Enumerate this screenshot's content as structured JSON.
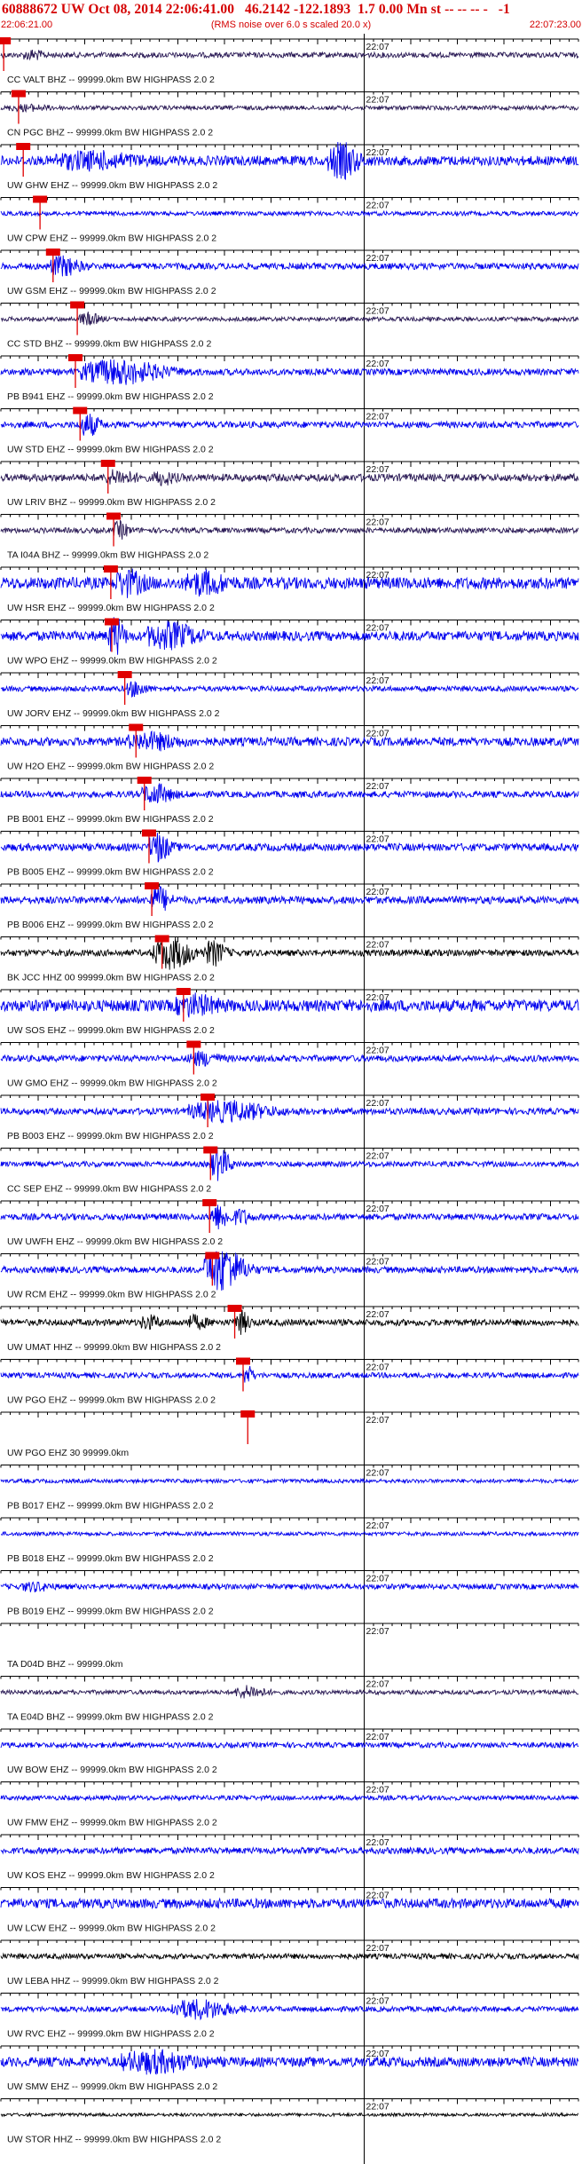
{
  "header": {
    "title": "60888672 UW Oct 08, 2014 22:06:41.00   46.2142 -122.1893  1.7 0.00 Mn st -- -- -- -   -1",
    "start_time": "22:06:21.00",
    "note": "(RMS noise over 6.0 s scaled 20.0 x)",
    "end_time": "22:07:23.00"
  },
  "colors": {
    "header_text": "#d40000",
    "trace_blue": "#0000ee",
    "trace_dark": "#2a1a55",
    "trace_black": "#000000",
    "pick_red": "#e00000",
    "axis": "#000000"
  },
  "chart_data": {
    "type": "line",
    "title": "60888672 UW Oct 08, 2014 22:06:41.00   46.2142 -122.1893  1.7 0.00 Mn st -- -- -- -   -1",
    "xlabel": "",
    "ylabel": "",
    "x_range": [
      "22:06:21.00",
      "22:07:23.00"
    ],
    "minute_tick_label": "22:07",
    "grid": true,
    "series": [
      {
        "name": "CC VALT BHZ -- 99999.0km BW  HIGHPASS  2.0  2",
        "color": "dark",
        "amp": 0.25,
        "pick": 0.3,
        "bursts": [
          {
            "at": 3,
            "w": 2,
            "a": 0.35
          }
        ]
      },
      {
        "name": "CN PGC BHZ -- 99999.0km BW  HIGHPASS  2.0  2",
        "color": "dark",
        "amp": 0.2,
        "pick": 1.9,
        "bursts": [
          {
            "at": 2,
            "w": 4,
            "a": 0.2
          }
        ]
      },
      {
        "name": "UW GHW EHZ -- 99999.0km BW  HIGHPASS  2.0  2",
        "color": "blue",
        "amp": 0.45,
        "pick": 2.4,
        "bursts": [
          {
            "at": 8,
            "w": 8,
            "a": 0.6
          },
          {
            "at": 36,
            "w": 3,
            "a": 1.4
          }
        ]
      },
      {
        "name": "UW CPW EHZ -- 99999.0km BW  HIGHPASS  2.0  2",
        "color": "blue",
        "amp": 0.2,
        "pick": 4.2,
        "bursts": []
      },
      {
        "name": "UW GSM EHZ -- 99999.0km BW  HIGHPASS  2.0  2",
        "color": "blue",
        "amp": 0.3,
        "pick": 5.6,
        "bursts": [
          {
            "at": 6,
            "w": 3,
            "a": 0.8
          }
        ]
      },
      {
        "name": "CC STD BHZ -- 99999.0km BW  HIGHPASS  2.0  2",
        "color": "dark",
        "amp": 0.2,
        "pick": 8.2,
        "bursts": [
          {
            "at": 9,
            "w": 2,
            "a": 0.5
          }
        ]
      },
      {
        "name": "PB B941 EHZ -- 99999.0km BW  HIGHPASS  2.0  2",
        "color": "blue",
        "amp": 0.3,
        "pick": 8.0,
        "bursts": [
          {
            "at": 11,
            "w": 8,
            "a": 1.0
          }
        ]
      },
      {
        "name": "UW STD EHZ -- 99999.0km BW  HIGHPASS  2.0  2",
        "color": "blue",
        "amp": 0.3,
        "pick": 8.5,
        "bursts": [
          {
            "at": 9,
            "w": 2,
            "a": 0.9
          }
        ]
      },
      {
        "name": "UW LRIV BHZ -- 99999.0km BW  HIGHPASS  2.0  2",
        "color": "dark",
        "amp": 0.35,
        "pick": 11.5,
        "bursts": [
          {
            "at": 12,
            "w": 3,
            "a": 0.5
          },
          {
            "at": 17,
            "w": 2,
            "a": 0.5
          }
        ]
      },
      {
        "name": "TA I04A BHZ -- 99999.0km BW  HIGHPASS  2.0  2",
        "color": "dark",
        "amp": 0.25,
        "pick": 12.1,
        "bursts": [
          {
            "at": 12.5,
            "w": 1.5,
            "a": 0.7
          }
        ]
      },
      {
        "name": "UW HSR EHZ -- 99999.0km BW  HIGHPASS  2.0  2",
        "color": "blue",
        "amp": 0.55,
        "pick": 11.8,
        "bursts": [
          {
            "at": 13,
            "w": 3,
            "a": 0.9
          },
          {
            "at": 21,
            "w": 4,
            "a": 0.8
          }
        ]
      },
      {
        "name": "UW WPO EHZ -- 99999.0km BW  HIGHPASS  2.0  2",
        "color": "blue",
        "amp": 0.45,
        "pick": 11.9,
        "bursts": [
          {
            "at": 12,
            "w": 1.5,
            "a": 1.6
          },
          {
            "at": 17,
            "w": 5,
            "a": 1.0
          }
        ]
      },
      {
        "name": "UW JORV EHZ -- 99999.0km BW  HIGHPASS  2.0  2",
        "color": "blue",
        "amp": 0.25,
        "pick": 13.3,
        "bursts": [
          {
            "at": 14,
            "w": 2,
            "a": 0.6
          }
        ]
      },
      {
        "name": "UW H2O EHZ -- 99999.0km BW  HIGHPASS  2.0  2",
        "color": "blue",
        "amp": 0.4,
        "pick": 14.5,
        "bursts": [
          {
            "at": 15,
            "w": 5,
            "a": 0.6
          }
        ]
      },
      {
        "name": "PB B001 EHZ -- 99999.0km BW  HIGHPASS  2.0  2",
        "color": "blue",
        "amp": 0.3,
        "pick": 15.4,
        "bursts": [
          {
            "at": 16,
            "w": 3,
            "a": 0.8
          }
        ]
      },
      {
        "name": "PB B005 EHZ -- 99999.0km BW  HIGHPASS  2.0  2",
        "color": "blue",
        "amp": 0.35,
        "pick": 15.9,
        "bursts": [
          {
            "at": 16.5,
            "w": 2,
            "a": 1.2
          }
        ]
      },
      {
        "name": "PB B006 EHZ -- 99999.0km BW  HIGHPASS  2.0  2",
        "color": "blue",
        "amp": 0.35,
        "pick": 16.2,
        "bursts": [
          {
            "at": 16.5,
            "w": 2,
            "a": 1.1
          }
        ]
      },
      {
        "name": "BK JCC HHZ 00 99999.0km BW  HIGHPASS  2.0  2",
        "color": "black",
        "amp": 0.3,
        "pick": 17.3,
        "bursts": [
          {
            "at": 17.5,
            "w": 4,
            "a": 1.3
          },
          {
            "at": 22.5,
            "w": 2,
            "a": 1.0
          }
        ]
      },
      {
        "name": "UW SOS EHZ -- 99999.0km BW  HIGHPASS  2.0  2",
        "color": "blue",
        "amp": 0.55,
        "pick": 19.6,
        "bursts": [
          {
            "at": 20,
            "w": 4,
            "a": 0.7
          }
        ]
      },
      {
        "name": "UW GMO EHZ -- 99999.0km BW  HIGHPASS  2.0  2",
        "color": "blue",
        "amp": 0.3,
        "pick": 20.7,
        "bursts": [
          {
            "at": 21,
            "w": 3,
            "a": 0.5
          }
        ]
      },
      {
        "name": "PB B003 EHZ -- 99999.0km BW  HIGHPASS  2.0  2",
        "color": "blue",
        "amp": 0.3,
        "pick": 22.2,
        "bursts": [
          {
            "at": 22.5,
            "w": 8,
            "a": 0.8
          }
        ]
      },
      {
        "name": "CC SEP EHZ -- 99999.0km BW  HIGHPASS  2.0  2",
        "color": "blue",
        "amp": 0.25,
        "pick": 22.5,
        "bursts": [
          {
            "at": 23,
            "w": 2,
            "a": 1.4
          }
        ]
      },
      {
        "name": "UW UWFH EHZ -- 99999.0km BW  HIGHPASS  2.0  2",
        "color": "blue",
        "amp": 0.3,
        "pick": 22.4,
        "bursts": [
          {
            "at": 23,
            "w": 2,
            "a": 1.0
          },
          {
            "at": 25.5,
            "w": 1.5,
            "a": 0.6
          }
        ]
      },
      {
        "name": "UW RCM EHZ -- 99999.0km BW  HIGHPASS  2.0  2",
        "color": "blue",
        "amp": 0.3,
        "pick": 22.7,
        "bursts": [
          {
            "at": 23,
            "w": 4,
            "a": 2.0
          }
        ]
      },
      {
        "name": "UW UMAT HHZ -- 99999.0km BW  HIGHPASS  2.0  2",
        "color": "black",
        "amp": 0.3,
        "pick": 25.1,
        "bursts": [
          {
            "at": 15.5,
            "w": 2,
            "a": 0.5
          },
          {
            "at": 20.5,
            "w": 2,
            "a": 0.5
          },
          {
            "at": 25.5,
            "w": 1.5,
            "a": 0.9
          }
        ]
      },
      {
        "name": "UW PGO EHZ -- 99999.0km BW  HIGHPASS  2.0  2",
        "color": "blue",
        "amp": 0.25,
        "pick": 26.0,
        "bursts": [
          {
            "at": 26.3,
            "w": 1,
            "a": 0.8
          }
        ]
      },
      {
        "name": "UW PGO EHZ 30 99999.0km",
        "color": "blue",
        "amp": 0.0,
        "pick": 26.5,
        "bursts": []
      },
      {
        "name": "PB B017 EHZ -- 99999.0km BW  HIGHPASS  2.0  2",
        "color": "blue",
        "amp": 0.18,
        "pick": null,
        "bursts": []
      },
      {
        "name": "PB B018 EHZ -- 99999.0km BW  HIGHPASS  2.0  2",
        "color": "blue",
        "amp": 0.18,
        "pick": null,
        "bursts": []
      },
      {
        "name": "PB B019 EHZ -- 99999.0km BW  HIGHPASS  2.0  2",
        "color": "blue",
        "amp": 0.25,
        "pick": null,
        "bursts": [
          {
            "at": 3,
            "w": 3,
            "a": 0.3
          }
        ]
      },
      {
        "name": "TA D04D BHZ -- 99999.0km",
        "color": "blue",
        "amp": 0.0,
        "pick": null,
        "bursts": []
      },
      {
        "name": "TA E04D BHZ -- 99999.0km BW  HIGHPASS  2.0  2",
        "color": "dark",
        "amp": 0.2,
        "pick": null,
        "bursts": [
          {
            "at": 26,
            "w": 3,
            "a": 0.5
          }
        ]
      },
      {
        "name": "UW BOW EHZ -- 99999.0km BW  HIGHPASS  2.0  2",
        "color": "blue",
        "amp": 0.25,
        "pick": null,
        "bursts": []
      },
      {
        "name": "UW FMW EHZ -- 99999.0km BW  HIGHPASS  2.0  2",
        "color": "blue",
        "amp": 0.22,
        "pick": null,
        "bursts": []
      },
      {
        "name": "UW KOS EHZ -- 99999.0km BW  HIGHPASS  2.0  2",
        "color": "blue",
        "amp": 0.3,
        "pick": null,
        "bursts": []
      },
      {
        "name": "UW LCW EHZ -- 99999.0km BW  HIGHPASS  2.0  2",
        "color": "blue",
        "amp": 0.45,
        "pick": null,
        "bursts": []
      },
      {
        "name": "UW LEBA HHZ -- 99999.0km BW  HIGHPASS  2.0  2",
        "color": "black",
        "amp": 0.25,
        "pick": null,
        "bursts": []
      },
      {
        "name": "UW RVC EHZ -- 99999.0km BW  HIGHPASS  2.0  2",
        "color": "blue",
        "amp": 0.25,
        "pick": null,
        "bursts": [
          {
            "at": 20,
            "w": 6,
            "a": 0.8
          }
        ]
      },
      {
        "name": "UW SMW EHZ -- 99999.0km BW  HIGHPASS  2.0  2",
        "color": "blue",
        "amp": 0.45,
        "pick": null,
        "bursts": [
          {
            "at": 15,
            "w": 7,
            "a": 0.8
          }
        ]
      },
      {
        "name": "UW STOR HHZ -- 99999.0km BW  HIGHPASS  2.0  2",
        "color": "black",
        "amp": 0.15,
        "pick": null,
        "bursts": []
      }
    ]
  }
}
